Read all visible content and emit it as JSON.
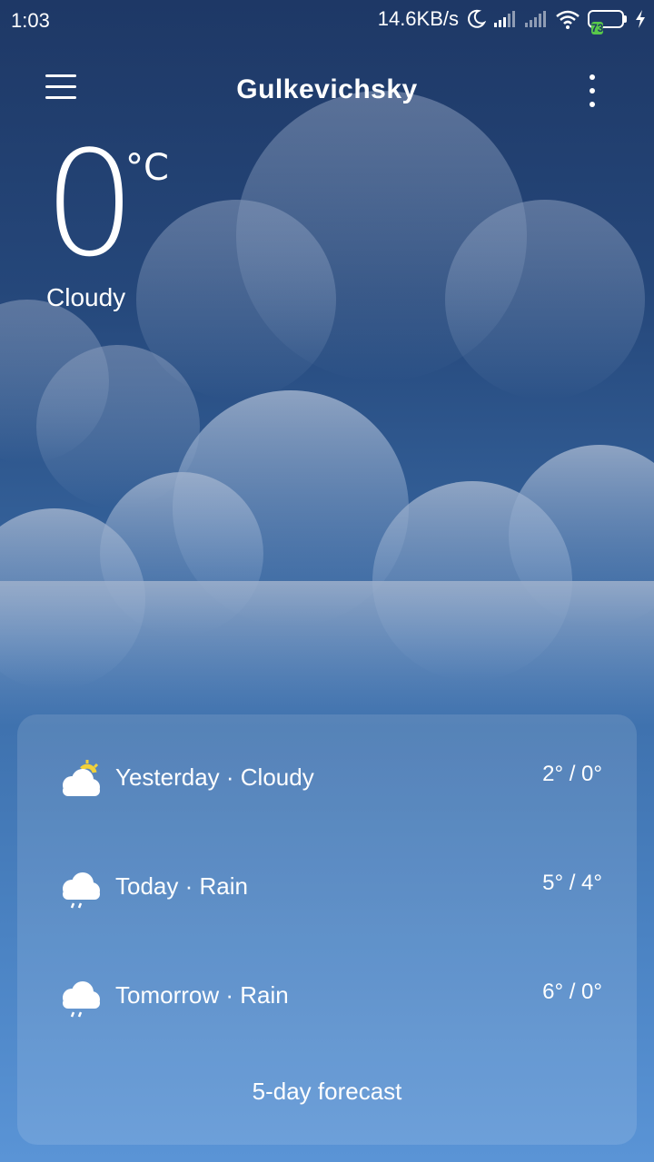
{
  "status_bar": {
    "time": "1:03",
    "net_speed": "14.6KB/s",
    "battery_level": "73",
    "icons": [
      "moon-icon",
      "signal-icon",
      "signal-icon",
      "wifi-icon",
      "battery-icon",
      "charging-icon"
    ]
  },
  "header": {
    "city": "Gulkevichsky",
    "menu_icon": "hamburger-menu-icon",
    "more_icon": "more-vertical-icon"
  },
  "current": {
    "temperature": "0",
    "unit": "°C",
    "condition": "Cloudy"
  },
  "forecast": {
    "rows": [
      {
        "icon": "cloud-sun-icon",
        "label": "Yesterday · Cloudy",
        "range": "2° / 0°"
      },
      {
        "icon": "cloud-rain-icon",
        "label": "Today · Rain",
        "range": "5° / 4°"
      },
      {
        "icon": "cloud-rain-icon",
        "label": "Tomorrow · Rain",
        "range": "6° / 0°"
      }
    ],
    "link_label": "5-day forecast"
  },
  "colors": {
    "bg_top": "#1e3866",
    "bg_bottom": "#5a94d6",
    "battery_fill": "#58c84a",
    "sun_accent": "#f2d23a"
  }
}
